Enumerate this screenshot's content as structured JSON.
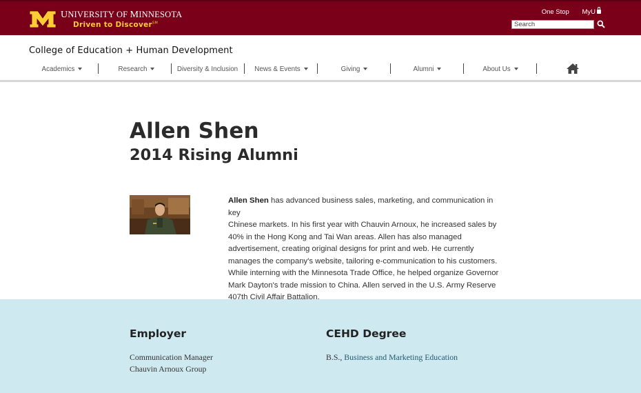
{
  "header": {
    "university_name_prefix": "U",
    "university_name_rest": "NIVERSITY OF ",
    "university_name_m": "M",
    "university_name_end": "INNESOTA",
    "tagline": "Driven to Discover",
    "tagline_mark": "SM",
    "links": {
      "one_stop": "One Stop",
      "myu": "MyU"
    },
    "search": {
      "placeholder": "Search",
      "value": ""
    },
    "brand_color": "#7a0019",
    "accent_color": "#ffcc33",
    "logo_icon": "block-m-icon",
    "search_icon": "magnifier-icon",
    "lock_icon": "lock-icon"
  },
  "college": {
    "title": "College of Education + Human Development"
  },
  "nav": {
    "items": [
      {
        "label": "Academics",
        "has_caret": true
      },
      {
        "label": "Research",
        "has_caret": true
      },
      {
        "label": "Diversity & Inclusion",
        "has_caret": false
      },
      {
        "label": "News & Events",
        "has_caret": true
      },
      {
        "label": "Giving",
        "has_caret": true
      },
      {
        "label": "Alumni",
        "has_caret": true
      },
      {
        "label": "About Us",
        "has_caret": true
      }
    ],
    "home_icon": "house-icon"
  },
  "profile": {
    "name": "Allen Shen",
    "subtitle": "2014 Rising Alumni",
    "bio_name": "Allen Shen",
    "bio_lines": [
      " has advanced business sales, marketing, and communication in key",
      "Chinese markets. In his first year with Chauvin Arnoux, he increased sales by",
      "40% in the Hong Kong and Tai Wan areas. Allen has also managed",
      "advertisement, creating original designs for print and web. He currently",
      "manages the company's website, tailoring e-communication to his customers.",
      "While interning with the Minnesota Trade Office, he helped organize Governor",
      "Mark Dayton's trade mission to China. Allen served in the U.S. Army Reserve",
      "407th Civil Affair Battalion."
    ]
  },
  "details": {
    "employer_heading": "Employer",
    "employer_title": "Communication Manager",
    "employer_company": "Chauvin Arnoux Group",
    "degree_heading": "CEHD Degree",
    "degree_prefix": "B.S., ",
    "degree_link": "Business and Marketing Education",
    "band_color": "#cfe9f1"
  }
}
